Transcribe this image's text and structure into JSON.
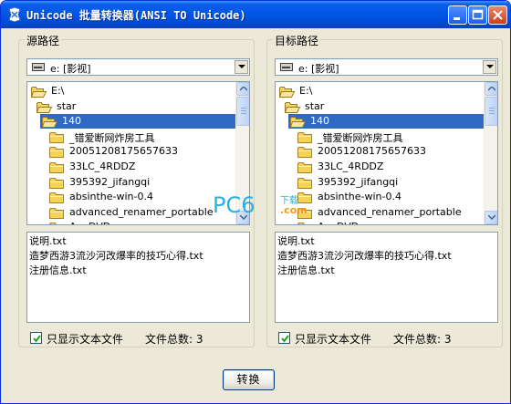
{
  "window": {
    "title": "Unicode 批量转换器(ANSI TO Unicode)"
  },
  "left": {
    "group_title": "源路径",
    "drive": "e: [影视]",
    "folders": [
      {
        "label": "E:\\",
        "open": true,
        "selected": false
      },
      {
        "label": "star",
        "open": true,
        "selected": false
      },
      {
        "label": "140",
        "open": true,
        "selected": true
      },
      {
        "label": "_错爱断网炸房工具",
        "open": false,
        "selected": false
      },
      {
        "label": "20051208175657633",
        "open": false,
        "selected": false
      },
      {
        "label": "33LC_4RDDZ",
        "open": false,
        "selected": false
      },
      {
        "label": "395392_jifangqi",
        "open": false,
        "selected": false
      },
      {
        "label": "absinthe-win-0.4",
        "open": false,
        "selected": false
      },
      {
        "label": "advanced_renamer_portable",
        "open": false,
        "selected": false
      },
      {
        "label": "AnyDVD",
        "open": false,
        "selected": false
      }
    ],
    "files": [
      "说明.txt",
      "造梦西游3流沙河改爆率的技巧心得.txt",
      "注册信息.txt"
    ],
    "checkbox_label": "只显示文本文件",
    "checkbox_checked": true,
    "file_count_label": "文件总数: 3"
  },
  "right": {
    "group_title": "目标路径",
    "drive": "e: [影视]",
    "folders": [
      {
        "label": "E:\\",
        "open": true,
        "selected": false
      },
      {
        "label": "star",
        "open": true,
        "selected": false
      },
      {
        "label": "140",
        "open": true,
        "selected": true
      },
      {
        "label": "_错爱断网炸房工具",
        "open": false,
        "selected": false
      },
      {
        "label": "20051208175657633",
        "open": false,
        "selected": false
      },
      {
        "label": "33LC_4RDDZ",
        "open": false,
        "selected": false
      },
      {
        "label": "395392_jifangqi",
        "open": false,
        "selected": false
      },
      {
        "label": "absinthe-win-0.4",
        "open": false,
        "selected": false
      },
      {
        "label": "advanced_renamer_portable",
        "open": false,
        "selected": false
      },
      {
        "label": "AnyDVD",
        "open": false,
        "selected": false
      }
    ],
    "files": [
      "说明.txt",
      "造梦西游3流沙河改爆率的技巧心得.txt",
      "注册信息.txt"
    ],
    "checkbox_label": "只显示文本文件",
    "checkbox_checked": true,
    "file_count_label": "文件总数: 3"
  },
  "convert_button": "转换",
  "watermark": {
    "main": "PC6",
    "small": "下载",
    "com": ".com"
  },
  "colors": {
    "titlebar": "#0055e5",
    "selection": "#316ac5",
    "folder": "#f5d25a",
    "face": "#ece9d8"
  }
}
